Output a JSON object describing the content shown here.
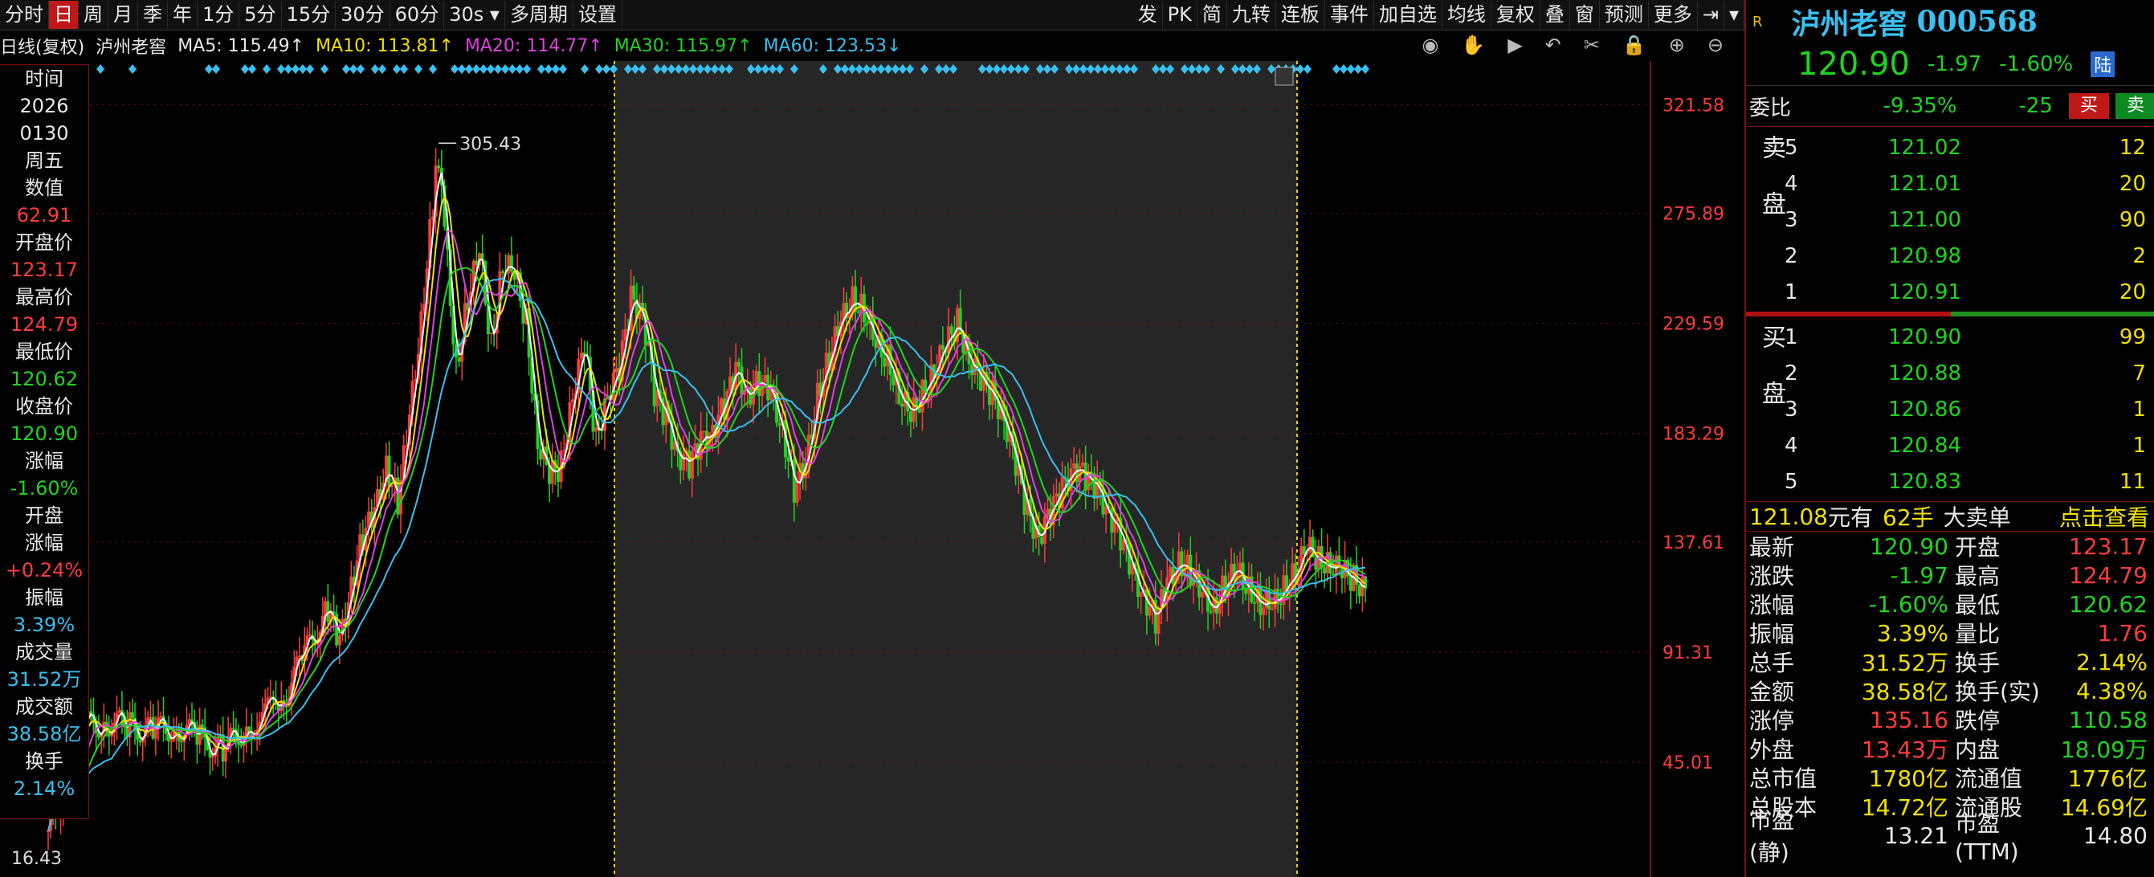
{
  "toolbar": {
    "left_items": [
      "分时",
      "日",
      "周",
      "月",
      "季",
      "年",
      "1分",
      "5分",
      "15分",
      "30分",
      "60分"
    ],
    "active_index": 1,
    "period_select": "30s",
    "multi_period": "多周期",
    "settings": "设置",
    "right_items": [
      "发",
      "PK",
      "简",
      "九转",
      "连板",
      "事件",
      "加自选",
      "均线",
      "复权",
      "叠",
      "窗",
      "预测",
      "更多"
    ]
  },
  "infobar": {
    "title": "日线(复权)",
    "stock": "泸州老窖",
    "ma5": "MA5: 115.49↑",
    "ma10": "MA10: 113.81↑",
    "ma20": "MA20: 114.77↑",
    "ma30": "MA30: 115.97↑",
    "ma60": "MA60: 123.53↓"
  },
  "chart_data": {
    "type": "candlestick",
    "y_ticks": [
      "321.58",
      "275.89",
      "229.59",
      "183.29",
      "137.61",
      "91.31",
      "45.01"
    ],
    "ylim": [
      0,
      340
    ],
    "high_label": "305.43",
    "low_label": "16.43",
    "series": [
      {
        "name": "MA5",
        "color": "#ffffff"
      },
      {
        "name": "MA10",
        "color": "#f0e000"
      },
      {
        "name": "MA20",
        "color": "#e040e0"
      },
      {
        "name": "MA30",
        "color": "#20d320"
      },
      {
        "name": "MA60",
        "color": "#39c0f0"
      }
    ],
    "close_path": [
      [
        0,
        16
      ],
      [
        3,
        35
      ],
      [
        6,
        60
      ],
      [
        10,
        62
      ],
      [
        14,
        60
      ],
      [
        18,
        58
      ],
      [
        22,
        60
      ],
      [
        26,
        55
      ],
      [
        30,
        50
      ],
      [
        34,
        60
      ],
      [
        40,
        70
      ],
      [
        44,
        90
      ],
      [
        48,
        110
      ],
      [
        50,
        95
      ],
      [
        52,
        120
      ],
      [
        54,
        140
      ],
      [
        56,
        150
      ],
      [
        58,
        170
      ],
      [
        60,
        155
      ],
      [
        62,
        190
      ],
      [
        64,
        230
      ],
      [
        66,
        280
      ],
      [
        67,
        300
      ],
      [
        68,
        270
      ],
      [
        70,
        210
      ],
      [
        72,
        240
      ],
      [
        74,
        260
      ],
      [
        76,
        220
      ],
      [
        78,
        255
      ],
      [
        80,
        250
      ],
      [
        82,
        230
      ],
      [
        84,
        180
      ],
      [
        86,
        165
      ],
      [
        88,
        170
      ],
      [
        90,
        200
      ],
      [
        92,
        220
      ],
      [
        94,
        180
      ],
      [
        96,
        200
      ],
      [
        98,
        210
      ],
      [
        100,
        240
      ],
      [
        102,
        235
      ],
      [
        104,
        200
      ],
      [
        106,
        190
      ],
      [
        108,
        175
      ],
      [
        110,
        170
      ],
      [
        112,
        180
      ],
      [
        114,
        185
      ],
      [
        116,
        195
      ],
      [
        118,
        210
      ],
      [
        120,
        200
      ],
      [
        122,
        205
      ],
      [
        124,
        200
      ],
      [
        126,
        185
      ],
      [
        128,
        160
      ],
      [
        130,
        170
      ],
      [
        132,
        200
      ],
      [
        134,
        215
      ],
      [
        136,
        230
      ],
      [
        138,
        240
      ],
      [
        140,
        235
      ],
      [
        142,
        220
      ],
      [
        144,
        215
      ],
      [
        146,
        200
      ],
      [
        148,
        190
      ],
      [
        150,
        200
      ],
      [
        152,
        210
      ],
      [
        154,
        220
      ],
      [
        156,
        230
      ],
      [
        158,
        215
      ],
      [
        160,
        205
      ],
      [
        162,
        200
      ],
      [
        164,
        190
      ],
      [
        166,
        170
      ],
      [
        168,
        150
      ],
      [
        170,
        140
      ],
      [
        172,
        150
      ],
      [
        174,
        160
      ],
      [
        176,
        170
      ],
      [
        178,
        165
      ],
      [
        180,
        160
      ],
      [
        182,
        150
      ],
      [
        184,
        140
      ],
      [
        186,
        125
      ],
      [
        188,
        115
      ],
      [
        190,
        105
      ],
      [
        192,
        120
      ],
      [
        194,
        130
      ],
      [
        196,
        125
      ],
      [
        198,
        115
      ],
      [
        200,
        110
      ],
      [
        202,
        120
      ],
      [
        204,
        125
      ],
      [
        206,
        118
      ],
      [
        208,
        112
      ],
      [
        210,
        110
      ],
      [
        212,
        118
      ],
      [
        214,
        125
      ],
      [
        216,
        135
      ],
      [
        218,
        130
      ],
      [
        220,
        128
      ],
      [
        222,
        125
      ],
      [
        224,
        122
      ],
      [
        226,
        118
      ]
    ]
  },
  "left_panel": [
    {
      "label": "时间",
      "value": "2026"
    },
    {
      "label": "",
      "value": "0130"
    },
    {
      "label": "",
      "value": "周五"
    },
    {
      "label": "数值",
      "value": "62.91"
    },
    {
      "label": "开盘价",
      "value": "123.17"
    },
    {
      "label": "最高价",
      "value": "124.79"
    },
    {
      "label": "最低价",
      "value": "120.62"
    },
    {
      "label": "收盘价",
      "value": "120.90"
    },
    {
      "label": "涨幅",
      "value": "-1.60%"
    },
    {
      "label": "开盘",
      "value": ""
    },
    {
      "label": "涨幅",
      "value": "+0.24%"
    },
    {
      "label": "振幅",
      "value": "3.39%"
    },
    {
      "label": "成交量",
      "value": "31.52万"
    },
    {
      "label": "成交额",
      "value": "38.58亿"
    },
    {
      "label": "换手",
      "value": "2.14%"
    }
  ],
  "right": {
    "badge": "R",
    "name": "泸州老窖",
    "code": "000568",
    "price": "120.90",
    "change": "-1.97",
    "change_pct": "-1.60%",
    "market_tag": "陆",
    "webi_label": "委比",
    "webi": "-9.35%",
    "webi_diff": "-25",
    "buy_btn": "买",
    "sell_btn": "卖",
    "sell_side_label": "卖盘",
    "buy_side_label": "买盘",
    "asks": [
      {
        "lv": "5",
        "price": "121.02",
        "vol": "12"
      },
      {
        "lv": "4",
        "price": "121.01",
        "vol": "20"
      },
      {
        "lv": "3",
        "price": "121.00",
        "vol": "90"
      },
      {
        "lv": "2",
        "price": "120.98",
        "vol": "2"
      },
      {
        "lv": "1",
        "price": "120.91",
        "vol": "20"
      }
    ],
    "bids": [
      {
        "lv": "1",
        "price": "120.90",
        "vol": "99"
      },
      {
        "lv": "2",
        "price": "120.88",
        "vol": "7"
      },
      {
        "lv": "3",
        "price": "120.86",
        "vol": "1"
      },
      {
        "lv": "4",
        "price": "120.84",
        "vol": "1"
      },
      {
        "lv": "5",
        "price": "120.83",
        "vol": "11"
      }
    ],
    "bigorder": {
      "price": "121.08",
      "text1": "元有",
      "qty": "62手",
      "text2": "大卖单",
      "link": "点击查看"
    },
    "stats": [
      {
        "k": "最新",
        "v": "120.90",
        "vc": "green",
        "k2": "开盘",
        "v2": "123.17",
        "v2c": "red"
      },
      {
        "k": "涨跌",
        "v": "-1.97",
        "vc": "green",
        "k2": "最高",
        "v2": "124.79",
        "v2c": "red"
      },
      {
        "k": "涨幅",
        "v": "-1.60%",
        "vc": "green",
        "k2": "最低",
        "v2": "120.62",
        "v2c": "green"
      },
      {
        "k": "振幅",
        "v": "3.39%",
        "vc": "yellow",
        "k2": "量比",
        "v2": "1.76",
        "v2c": "red"
      },
      {
        "k": "总手",
        "v": "31.52万",
        "vc": "yellow",
        "k2": "换手",
        "v2": "2.14%",
        "v2c": "yellow"
      },
      {
        "k": "金额",
        "v": "38.58亿",
        "vc": "yellow",
        "k2": "换手(实)",
        "v2": "4.38%",
        "v2c": "yellow"
      },
      {
        "k": "涨停",
        "v": "135.16",
        "vc": "red",
        "k2": "跌停",
        "v2": "110.58",
        "v2c": "green"
      },
      {
        "k": "外盘",
        "v": "13.43万",
        "vc": "red",
        "k2": "内盘",
        "v2": "18.09万",
        "v2c": "green"
      },
      {
        "k": "总市值",
        "v": "1780亿",
        "vc": "yellow",
        "k2": "流通值",
        "v2": "1776亿",
        "v2c": "yellow"
      },
      {
        "k": "总股本",
        "v": "14.72亿",
        "vc": "yellow",
        "k2": "流通股",
        "v2": "14.69亿",
        "v2c": "yellow"
      },
      {
        "k": "市盈(静)",
        "v": "13.21",
        "vc": "white",
        "k2": "市盈(TTM)",
        "v2": "14.80",
        "v2c": "white"
      }
    ]
  }
}
